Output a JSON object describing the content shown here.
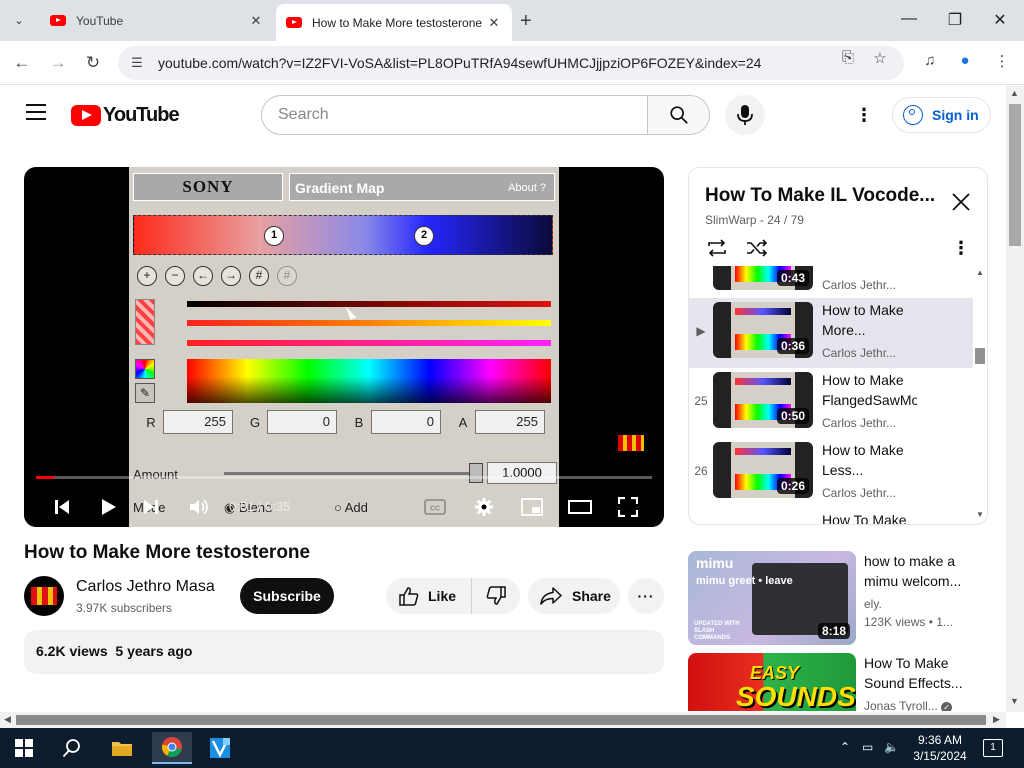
{
  "browser": {
    "tabs": [
      {
        "title": "YouTube",
        "active": false
      },
      {
        "title": "How to Make More testosterone",
        "active": true
      }
    ],
    "url": "youtube.com/watch?v=IZ2FVI-VoSA&list=PL8OPuTRfA94sewfUHMCJjjpziOP6FOZEY&index=24"
  },
  "masthead": {
    "logo_text": "YouTube",
    "search_placeholder": "Search",
    "sign_in_label": "Sign in"
  },
  "player": {
    "current_time": "0:01",
    "duration": "0:35",
    "time_display": "0:01 / 0:35",
    "progress_fraction": 0.03,
    "frame": {
      "brand": "SONY",
      "window_title": "Gradient Map",
      "about_label": "About",
      "stop_labels": [
        "1",
        "2"
      ],
      "channels": [
        {
          "label": "R",
          "value": "255"
        },
        {
          "label": "G",
          "value": "0"
        },
        {
          "label": "B",
          "value": "0"
        },
        {
          "label": "A",
          "value": "255"
        }
      ],
      "amount_label": "Amount",
      "amount_value": "1.0000",
      "mode_label": "Mode",
      "blend_label": "Blend",
      "add_label": "Add"
    }
  },
  "video": {
    "title": "How to Make More testosterone",
    "channel": "Carlos Jethro Masa",
    "subscribers": "3.97K subscribers",
    "subscribe_label": "Subscribe",
    "like_label": "Like",
    "share_label": "Share",
    "views": "6.2K views",
    "age": "5 years ago"
  },
  "playlist": {
    "title": "How To Make IL Vocode...",
    "subtitle": "SlimWarp - 24 / 79",
    "items": [
      {
        "index": "",
        "title": "",
        "channel": "Carlos Jethr...",
        "duration": "0:43",
        "active": false
      },
      {
        "index": "▶",
        "title": "How to Make More...",
        "channel": "Carlos Jethr...",
        "duration": "0:36",
        "active": true
      },
      {
        "index": "25",
        "title": "How to Make FlangedSawMo",
        "channel": "Carlos Jethr...",
        "duration": "0:50",
        "active": false
      },
      {
        "index": "26",
        "title": "How to Make Less...",
        "channel": "Carlos Jethr...",
        "duration": "0:26",
        "active": false
      },
      {
        "index": "",
        "title": "How To Make",
        "channel": "",
        "duration": "",
        "active": false
      }
    ]
  },
  "recommendations": [
    {
      "title": "how to make a mimu welcom...",
      "channel": "ely.",
      "meta": "123K views • 1...",
      "duration": "8:18",
      "thumb_text": "mimu greet • leave",
      "thumb_sub": "UPDATED WITH SLASH COMMANDS"
    },
    {
      "title": "How To Make Sound Effects...",
      "channel": "Jonas Tyroll...",
      "meta": "",
      "duration": "",
      "thumb_text": "SOUNDS",
      "thumb_sub": "EASY"
    }
  ],
  "taskbar": {
    "time": "9:36 AM",
    "date": "3/15/2024",
    "notifications": "1"
  },
  "colors": {
    "accent_red": "#ff0000",
    "link_blue": "#065fd4",
    "taskbar": "#0e1d2e"
  }
}
